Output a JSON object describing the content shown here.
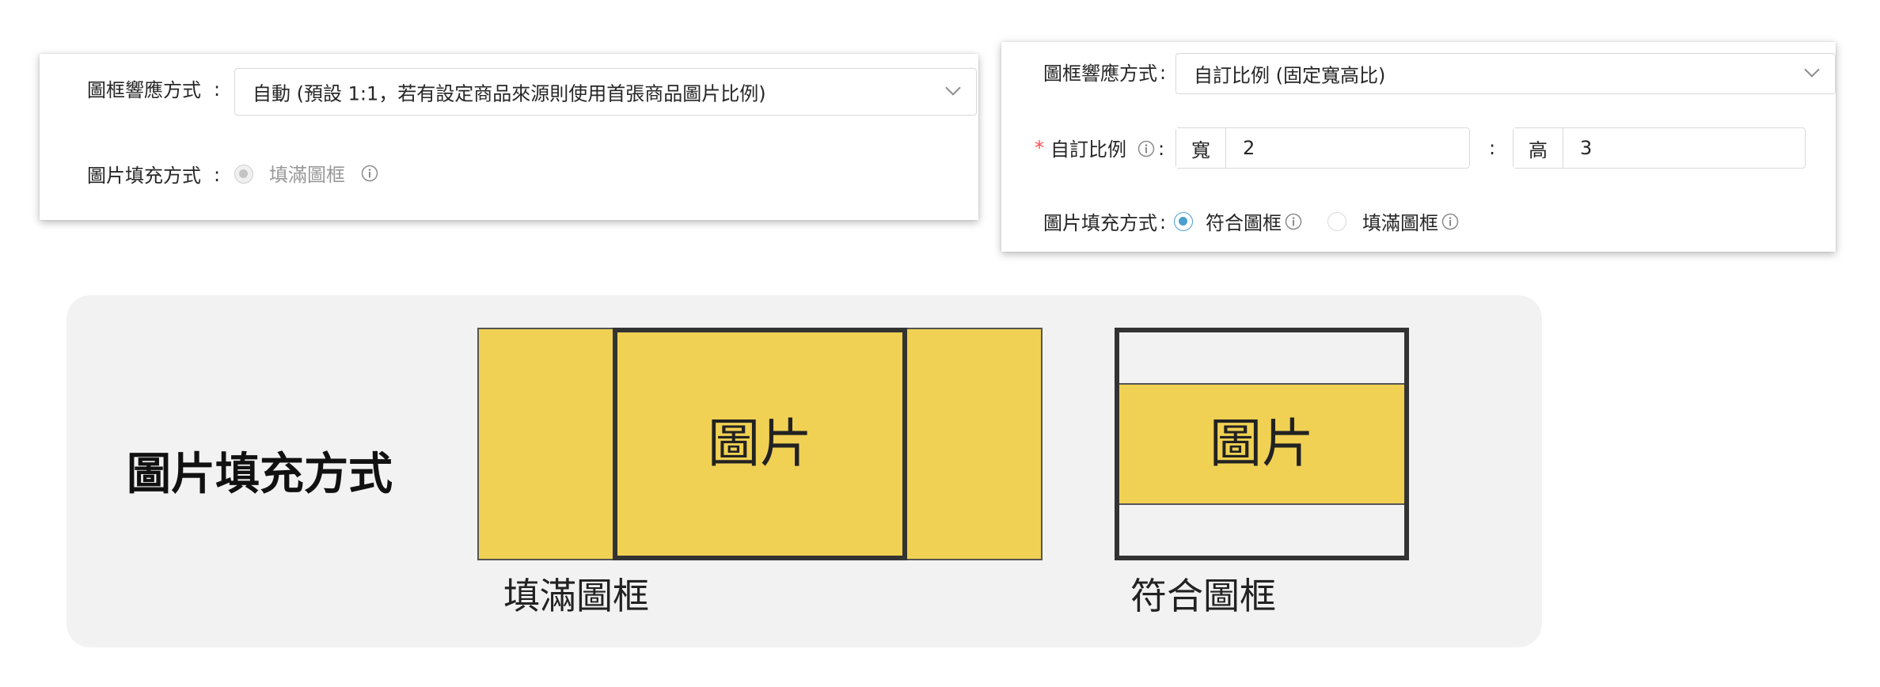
{
  "left_panel": {
    "frame_mode_label": "圖框響應方式",
    "frame_mode_value": "自動 (預設 1:1，若有設定商品來源則使用首張商品圖片比例)",
    "fill_mode_label": "圖片填充方式",
    "fill_option_label": "填滿圖框",
    "colon": ":"
  },
  "right_panel": {
    "frame_mode_label": "圖框響應方式",
    "frame_mode_value": "自訂比例 (固定寬高比)",
    "required_mark": "*",
    "ratio_label": "自訂比例",
    "width_addon": "寬",
    "width_value": "2",
    "ratio_separator": ":",
    "height_addon": "高",
    "height_value": "3",
    "fill_mode_label": "圖片填充方式",
    "fit_option_label": "符合圖框",
    "fill_option_label": "填滿圖框",
    "colon": ":",
    "accent_color": "#4a9fd0",
    "required_color": "#ff4d4f"
  },
  "diagram": {
    "title": "圖片填充方式",
    "fill_image_text": "圖片",
    "fill_caption": "填滿圖框",
    "fit_image_text": "圖片",
    "fit_caption": "符合圖框",
    "image_color": "#f0d153",
    "frame_color": "#333333"
  }
}
